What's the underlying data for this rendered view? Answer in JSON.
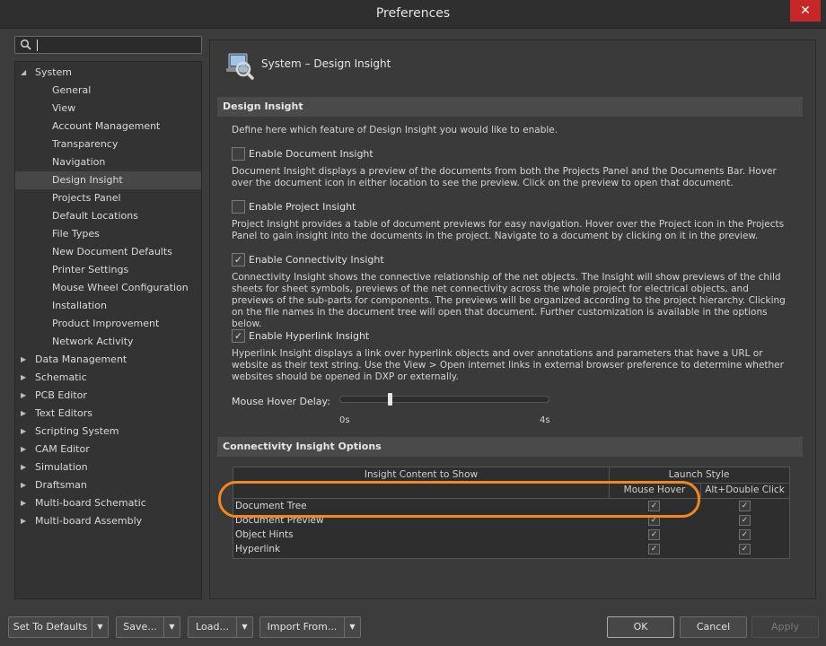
{
  "window": {
    "title": "Preferences"
  },
  "search": {
    "placeholder": ""
  },
  "tree": {
    "items": [
      {
        "label": "System",
        "expandable": true,
        "expanded": true,
        "level": 0
      },
      {
        "label": "General",
        "level": 1
      },
      {
        "label": "View",
        "level": 1
      },
      {
        "label": "Account Management",
        "level": 1
      },
      {
        "label": "Transparency",
        "level": 1
      },
      {
        "label": "Navigation",
        "level": 1
      },
      {
        "label": "Design Insight",
        "level": 1,
        "selected": true
      },
      {
        "label": "Projects Panel",
        "level": 1
      },
      {
        "label": "Default Locations",
        "level": 1
      },
      {
        "label": "File Types",
        "level": 1
      },
      {
        "label": "New Document Defaults",
        "level": 1
      },
      {
        "label": "Printer Settings",
        "level": 1
      },
      {
        "label": "Mouse Wheel Configuration",
        "level": 1
      },
      {
        "label": "Installation",
        "level": 1
      },
      {
        "label": "Product Improvement",
        "level": 1
      },
      {
        "label": "Network Activity",
        "level": 1
      },
      {
        "label": "Data Management",
        "expandable": true,
        "level": 0
      },
      {
        "label": "Schematic",
        "expandable": true,
        "level": 0
      },
      {
        "label": "PCB Editor",
        "expandable": true,
        "level": 0
      },
      {
        "label": "Text Editors",
        "expandable": true,
        "level": 0
      },
      {
        "label": "Scripting System",
        "expandable": true,
        "level": 0
      },
      {
        "label": "CAM Editor",
        "expandable": true,
        "level": 0
      },
      {
        "label": "Simulation",
        "expandable": true,
        "level": 0
      },
      {
        "label": "Draftsman",
        "expandable": true,
        "level": 0
      },
      {
        "label": "Multi-board Schematic",
        "expandable": true,
        "level": 0
      },
      {
        "label": "Multi-board Assembly",
        "expandable": true,
        "level": 0
      }
    ]
  },
  "page": {
    "title": "System – Design Insight",
    "icon": "design-insight-icon"
  },
  "design_insight": {
    "header": "Design Insight",
    "intro": "Define here which feature of Design Insight you would like to enable.",
    "options": [
      {
        "label": "Enable Document Insight",
        "checked": false,
        "description": "Document Insight displays a preview of the documents from both the Projects Panel and the Documents Bar. Hover over the document icon in either location to see the preview. Click on the preview to open that document."
      },
      {
        "label": "Enable Project Insight",
        "checked": false,
        "description": "Project Insight provides a table of document previews for easy navigation. Hover over the Project icon in the Projects Panel to gain insight into the documents in the project. Navigate to a document by clicking on it in the preview."
      },
      {
        "label": "Enable Connectivity Insight",
        "checked": true,
        "description": "Connectivity Insight shows the connective relationship of the net objects. The Insight will show previews of the child sheets for sheet symbols, previews of the net connectivity across the whole project for electrical objects, and previews of the sub-parts for components. The previews will be organized according to the project hierarchy. Clicking on the file names in the document tree will open that document. Further customization is available in the options below."
      },
      {
        "label": "Enable Hyperlink Insight",
        "checked": true,
        "description": "Hyperlink Insight displays a link over hyperlink objects and over annotations and parameters that have a URL or website as their text string. Use the View > Open internet links in external browser preference to determine whether websites should be opened in DXP or externally."
      }
    ],
    "hover_delay": {
      "label": "Mouse Hover Delay:",
      "min_label": "0s",
      "max_label": "4s",
      "value_fraction": 0.24
    }
  },
  "connectivity_options": {
    "header": "Connectivity Insight Options",
    "group_content": "Insight Content to Show",
    "group_launch": "Launch Style",
    "col_hover": "Mouse Hover",
    "col_alt": "Alt+Double Click",
    "rows": [
      {
        "label": "Document Tree",
        "hover": true,
        "alt": true
      },
      {
        "label": "Document Preview",
        "hover": true,
        "alt": true
      },
      {
        "label": "Object Hints",
        "hover": true,
        "alt": true
      },
      {
        "label": "Hyperlink",
        "hover": true,
        "alt": true
      }
    ]
  },
  "footer": {
    "set_defaults": "Set To Defaults",
    "save": "Save...",
    "load": "Load...",
    "import_from": "Import From...",
    "ok": "OK",
    "cancel": "Cancel",
    "apply": "Apply"
  },
  "colors": {
    "accent_ring": "#f0881f",
    "close_red": "#c62828"
  }
}
